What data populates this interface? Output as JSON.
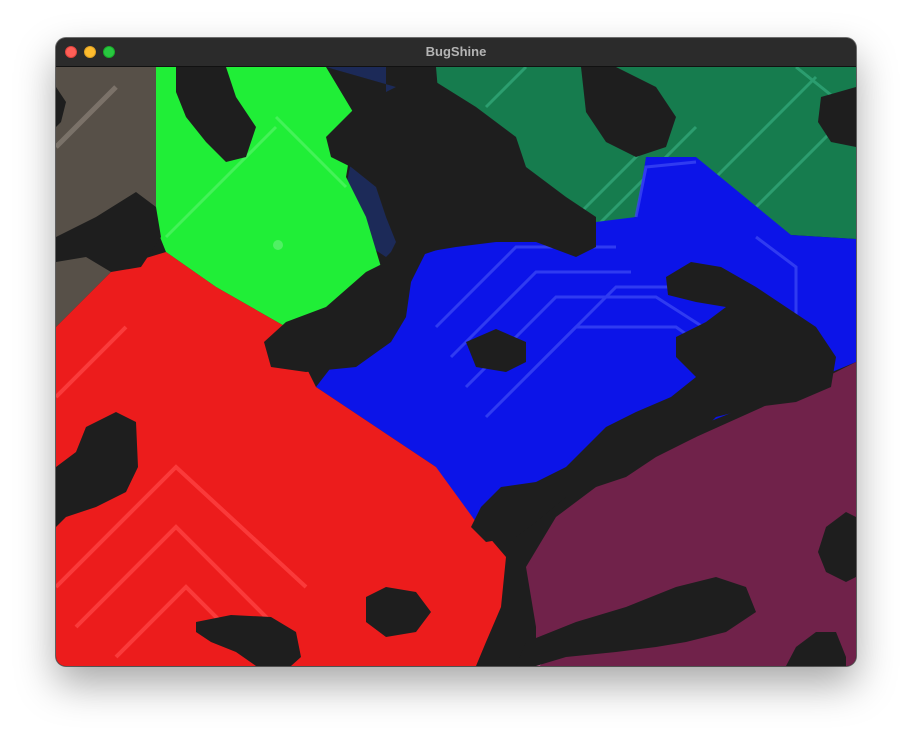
{
  "window": {
    "title": "BugShine"
  },
  "canvas": {
    "description": "",
    "background": "#1e1e1e",
    "region_colors": {
      "taupe": "#575048",
      "bright_green": "#20ee37",
      "dark_green": "#167c4e",
      "navy": "#1c2a58",
      "blue": "#0c14e8",
      "red": "#ec1c1c",
      "maroon": "#70224a",
      "black_blob": "#1e1e1e"
    }
  }
}
